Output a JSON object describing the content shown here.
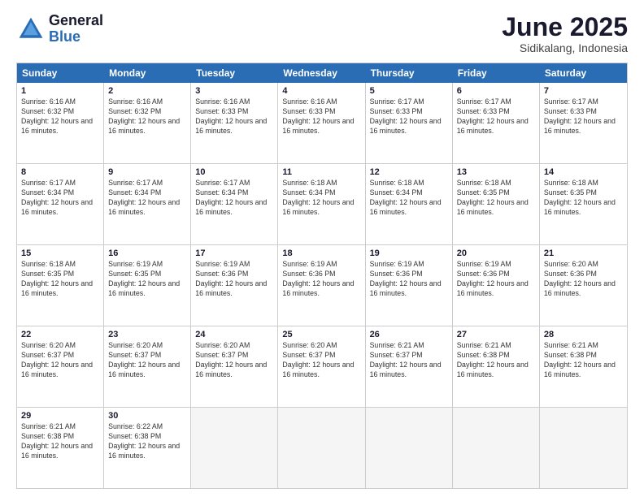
{
  "header": {
    "logo_general": "General",
    "logo_blue": "Blue",
    "month_title": "June 2025",
    "location": "Sidikalang, Indonesia"
  },
  "calendar": {
    "days_of_week": [
      "Sunday",
      "Monday",
      "Tuesday",
      "Wednesday",
      "Thursday",
      "Friday",
      "Saturday"
    ],
    "rows": [
      [
        {
          "day": "1",
          "sunrise": "6:16 AM",
          "sunset": "6:32 PM",
          "daylight": "12 hours and 16 minutes."
        },
        {
          "day": "2",
          "sunrise": "6:16 AM",
          "sunset": "6:32 PM",
          "daylight": "12 hours and 16 minutes."
        },
        {
          "day": "3",
          "sunrise": "6:16 AM",
          "sunset": "6:33 PM",
          "daylight": "12 hours and 16 minutes."
        },
        {
          "day": "4",
          "sunrise": "6:16 AM",
          "sunset": "6:33 PM",
          "daylight": "12 hours and 16 minutes."
        },
        {
          "day": "5",
          "sunrise": "6:17 AM",
          "sunset": "6:33 PM",
          "daylight": "12 hours and 16 minutes."
        },
        {
          "day": "6",
          "sunrise": "6:17 AM",
          "sunset": "6:33 PM",
          "daylight": "12 hours and 16 minutes."
        },
        {
          "day": "7",
          "sunrise": "6:17 AM",
          "sunset": "6:33 PM",
          "daylight": "12 hours and 16 minutes."
        }
      ],
      [
        {
          "day": "8",
          "sunrise": "6:17 AM",
          "sunset": "6:34 PM",
          "daylight": "12 hours and 16 minutes."
        },
        {
          "day": "9",
          "sunrise": "6:17 AM",
          "sunset": "6:34 PM",
          "daylight": "12 hours and 16 minutes."
        },
        {
          "day": "10",
          "sunrise": "6:17 AM",
          "sunset": "6:34 PM",
          "daylight": "12 hours and 16 minutes."
        },
        {
          "day": "11",
          "sunrise": "6:18 AM",
          "sunset": "6:34 PM",
          "daylight": "12 hours and 16 minutes."
        },
        {
          "day": "12",
          "sunrise": "6:18 AM",
          "sunset": "6:34 PM",
          "daylight": "12 hours and 16 minutes."
        },
        {
          "day": "13",
          "sunrise": "6:18 AM",
          "sunset": "6:35 PM",
          "daylight": "12 hours and 16 minutes."
        },
        {
          "day": "14",
          "sunrise": "6:18 AM",
          "sunset": "6:35 PM",
          "daylight": "12 hours and 16 minutes."
        }
      ],
      [
        {
          "day": "15",
          "sunrise": "6:18 AM",
          "sunset": "6:35 PM",
          "daylight": "12 hours and 16 minutes."
        },
        {
          "day": "16",
          "sunrise": "6:19 AM",
          "sunset": "6:35 PM",
          "daylight": "12 hours and 16 minutes."
        },
        {
          "day": "17",
          "sunrise": "6:19 AM",
          "sunset": "6:36 PM",
          "daylight": "12 hours and 16 minutes."
        },
        {
          "day": "18",
          "sunrise": "6:19 AM",
          "sunset": "6:36 PM",
          "daylight": "12 hours and 16 minutes."
        },
        {
          "day": "19",
          "sunrise": "6:19 AM",
          "sunset": "6:36 PM",
          "daylight": "12 hours and 16 minutes."
        },
        {
          "day": "20",
          "sunrise": "6:19 AM",
          "sunset": "6:36 PM",
          "daylight": "12 hours and 16 minutes."
        },
        {
          "day": "21",
          "sunrise": "6:20 AM",
          "sunset": "6:36 PM",
          "daylight": "12 hours and 16 minutes."
        }
      ],
      [
        {
          "day": "22",
          "sunrise": "6:20 AM",
          "sunset": "6:37 PM",
          "daylight": "12 hours and 16 minutes."
        },
        {
          "day": "23",
          "sunrise": "6:20 AM",
          "sunset": "6:37 PM",
          "daylight": "12 hours and 16 minutes."
        },
        {
          "day": "24",
          "sunrise": "6:20 AM",
          "sunset": "6:37 PM",
          "daylight": "12 hours and 16 minutes."
        },
        {
          "day": "25",
          "sunrise": "6:20 AM",
          "sunset": "6:37 PM",
          "daylight": "12 hours and 16 minutes."
        },
        {
          "day": "26",
          "sunrise": "6:21 AM",
          "sunset": "6:37 PM",
          "daylight": "12 hours and 16 minutes."
        },
        {
          "day": "27",
          "sunrise": "6:21 AM",
          "sunset": "6:38 PM",
          "daylight": "12 hours and 16 minutes."
        },
        {
          "day": "28",
          "sunrise": "6:21 AM",
          "sunset": "6:38 PM",
          "daylight": "12 hours and 16 minutes."
        }
      ],
      [
        {
          "day": "29",
          "sunrise": "6:21 AM",
          "sunset": "6:38 PM",
          "daylight": "12 hours and 16 minutes."
        },
        {
          "day": "30",
          "sunrise": "6:22 AM",
          "sunset": "6:38 PM",
          "daylight": "12 hours and 16 minutes."
        },
        {
          "day": "",
          "sunrise": "",
          "sunset": "",
          "daylight": ""
        },
        {
          "day": "",
          "sunrise": "",
          "sunset": "",
          "daylight": ""
        },
        {
          "day": "",
          "sunrise": "",
          "sunset": "",
          "daylight": ""
        },
        {
          "day": "",
          "sunrise": "",
          "sunset": "",
          "daylight": ""
        },
        {
          "day": "",
          "sunrise": "",
          "sunset": "",
          "daylight": ""
        }
      ]
    ]
  }
}
